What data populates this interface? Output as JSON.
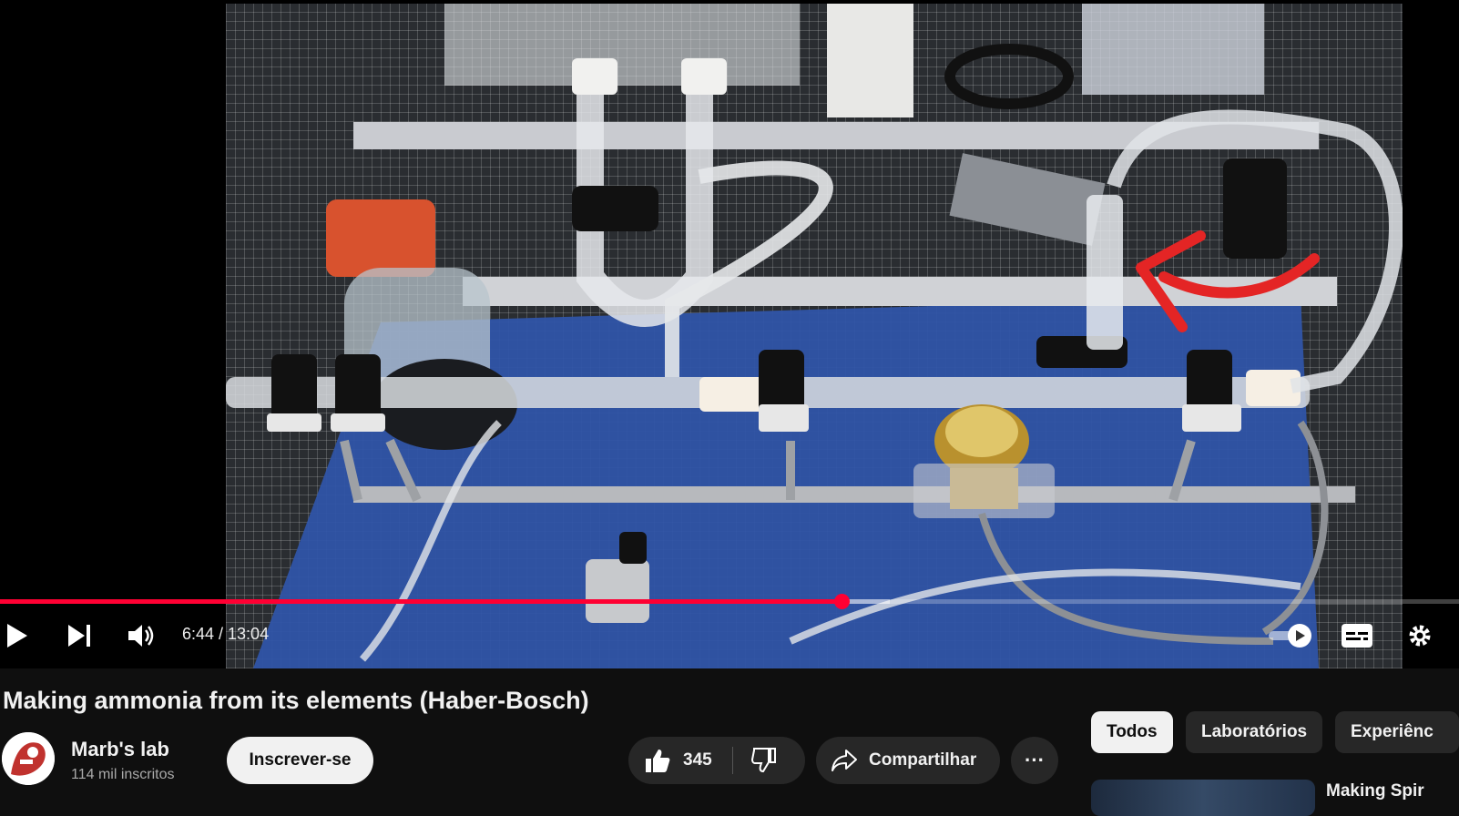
{
  "player": {
    "current_time": "6:44",
    "duration": "13:04",
    "time_display": "6:44 / 13:04",
    "progress_fraction": 0.577,
    "buffered_fraction": 0.61,
    "accent_color": "#ff0033",
    "controls": {
      "play": "play-icon",
      "next": "next-icon",
      "volume": "volume-icon",
      "autoplay": "autoplay-toggle-icon",
      "subtitles": "subtitles-icon",
      "settings": "gear-icon"
    }
  },
  "video": {
    "title": "Making ammonia from its elements (Haber-Bosch)"
  },
  "channel": {
    "name": "Marb's lab",
    "subscribers": "114 mil inscritos",
    "subscribe_label": "Inscrever-se"
  },
  "actions": {
    "like_count": "345",
    "share_label": "Compartilhar",
    "more_label": "···"
  },
  "chips": [
    "Todos",
    "Laboratórios",
    "Experiênc"
  ],
  "recommendation": {
    "title": "Making Spir"
  }
}
